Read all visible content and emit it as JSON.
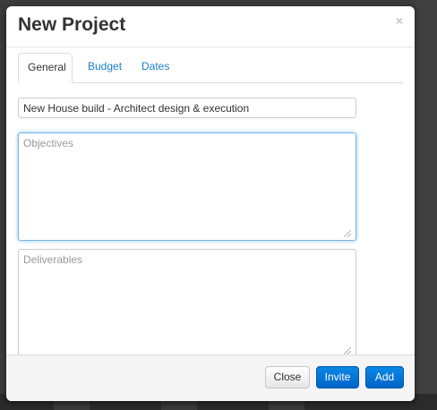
{
  "dialog": {
    "title": "New Project",
    "close_glyph": "×"
  },
  "tabs": [
    {
      "label": "General",
      "active": true
    },
    {
      "label": "Budget",
      "active": false
    },
    {
      "label": "Dates",
      "active": false
    }
  ],
  "form": {
    "project_name": {
      "value": "New House build - Architect design & execution"
    },
    "objectives": {
      "value": "",
      "placeholder": "Objectives"
    },
    "deliverables": {
      "value": "",
      "placeholder": "Deliverables"
    }
  },
  "footer": {
    "close_label": "Close",
    "invite_label": "Invite",
    "add_label": "Add"
  },
  "colors": {
    "primary": "#0a74d8",
    "link": "#1b7ec9",
    "focus": "#7bb6e6"
  },
  "icons": {
    "close": "close-icon",
    "resize": "resize-grip-icon"
  }
}
